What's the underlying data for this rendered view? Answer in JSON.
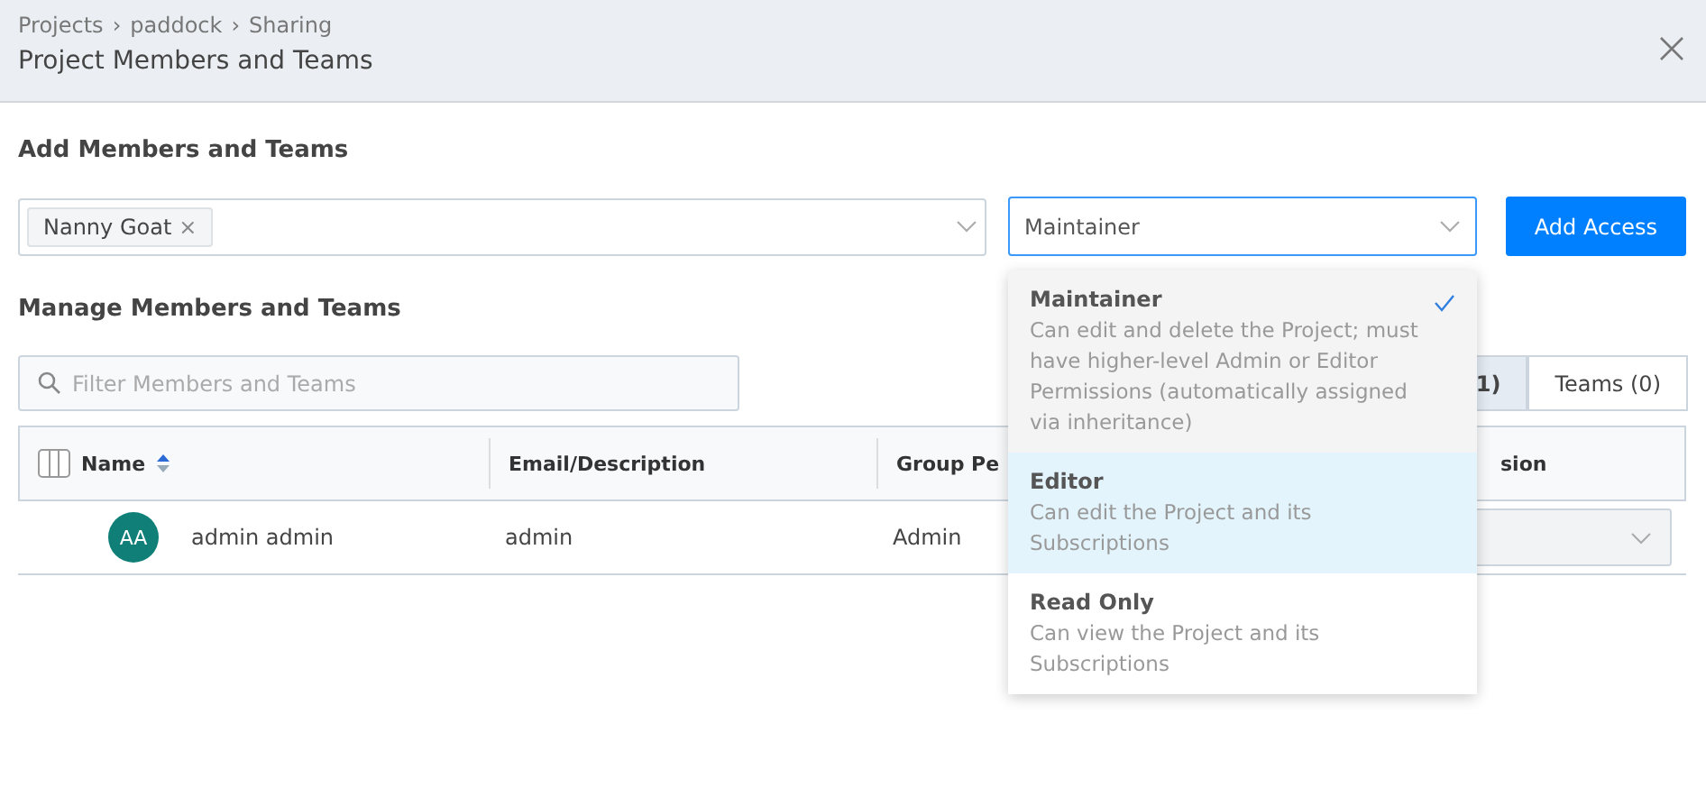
{
  "header": {
    "breadcrumbs": [
      "Projects",
      "paddock",
      "Sharing"
    ],
    "separator": "›",
    "title": "Project Members and Teams"
  },
  "add_section": {
    "title": "Add Members and Teams",
    "tags": [
      {
        "label": "Nanny Goat",
        "remove": "×"
      }
    ],
    "role_select": {
      "value": "Maintainer",
      "open": true
    },
    "button": "Add Access"
  },
  "role_options": [
    {
      "label": "Maintainer",
      "description": "Can edit and delete the Project; must have higher-level Admin or Editor Permissions (automatically assigned via inheritance)",
      "selected": true,
      "highlighted": false
    },
    {
      "label": "Editor",
      "description": "Can edit the Project and its Subscriptions",
      "selected": false,
      "highlighted": true
    },
    {
      "label": "Read Only",
      "description": "Can view the Project and its Subscriptions",
      "selected": false,
      "highlighted": false
    }
  ],
  "manage_section": {
    "title": "Manage Members and Teams",
    "filter": {
      "placeholder": "Filter Members and Teams"
    },
    "tabs": [
      {
        "label": "1)",
        "selected": true
      },
      {
        "label": "Teams (0)",
        "selected": false
      }
    ],
    "table": {
      "columns": [
        "Name",
        "Email/Description",
        "Group Pe",
        "sion"
      ],
      "rows": [
        {
          "initials": "AA",
          "name": "admin admin",
          "email": "admin",
          "group": "Admin"
        }
      ]
    }
  }
}
